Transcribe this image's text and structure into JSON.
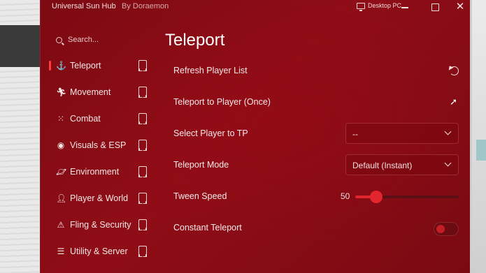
{
  "window": {
    "app_title": "Universal Sun Hub",
    "author": "By Doraemon",
    "device_label": "Desktop PC",
    "device_icon": "monitor-icon"
  },
  "sidebar": {
    "search_placeholder": "Search...",
    "items": [
      {
        "label": "Teleport",
        "icon": "anchor-icon",
        "active": true
      },
      {
        "label": "Movement",
        "icon": "running-icon"
      },
      {
        "label": "Combat",
        "icon": "loader-icon"
      },
      {
        "label": "Visuals & ESP",
        "icon": "eye-icon"
      },
      {
        "label": "Environment",
        "icon": "planet-icon"
      },
      {
        "label": "Player & World",
        "icon": "user-icon"
      },
      {
        "label": "Fling & Security",
        "icon": "warning-icon"
      },
      {
        "label": "Utility & Server",
        "icon": "server-icon"
      }
    ]
  },
  "main": {
    "title": "Teleport",
    "rows": {
      "refresh": {
        "label": "Refresh Player List"
      },
      "teleport_once": {
        "label": "Teleport to Player (Once)"
      },
      "select_player": {
        "label": "Select Player to TP",
        "value": "--"
      },
      "teleport_mode": {
        "label": "Teleport Mode",
        "value": "Default (Instant)"
      },
      "tween_speed": {
        "label": "Tween Speed",
        "value": "50",
        "fraction": 0.2
      },
      "constant_teleport": {
        "label": "Constant Teleport",
        "enabled": false
      }
    }
  },
  "colors": {
    "window_bg": "#8a0c15",
    "accent": "#e0252c",
    "text": "#f6e9e9"
  }
}
